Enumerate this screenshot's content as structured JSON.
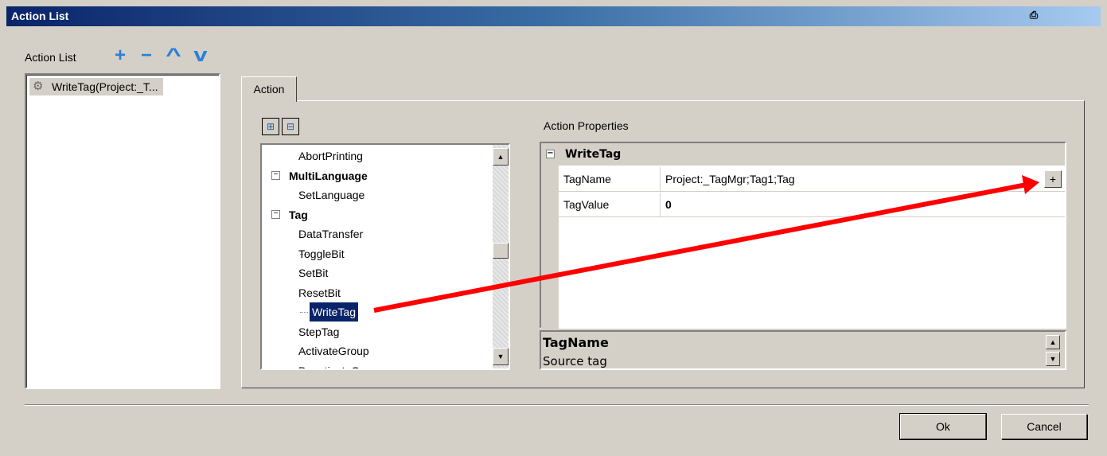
{
  "window": {
    "title": "Action List",
    "title_icon": "printer-icon"
  },
  "action_list": {
    "label": "Action List",
    "toolbar_icons": [
      "plus-icon",
      "minus-icon",
      "up-icon",
      "down-icon"
    ],
    "toolbar_glyphs": [
      "+",
      "−",
      "^",
      "v"
    ],
    "items": [
      {
        "label": "WriteTag(Project:_T...",
        "icon": "gear-icon"
      }
    ]
  },
  "tabs": [
    {
      "label": "Action"
    }
  ],
  "tree": {
    "items": [
      {
        "label": "AbortPrinting",
        "level": 2
      },
      {
        "label": "MultiLanguage",
        "level": 1,
        "expander": "−"
      },
      {
        "label": "SetLanguage",
        "level": 2
      },
      {
        "label": "Tag",
        "level": 1,
        "expander": "−"
      },
      {
        "label": "DataTransfer",
        "level": 2
      },
      {
        "label": "ToggleBit",
        "level": 2
      },
      {
        "label": "SetBit",
        "level": 2
      },
      {
        "label": "ResetBit",
        "level": 2
      },
      {
        "label": "WriteTag",
        "level": 2,
        "selected": true
      },
      {
        "label": "StepTag",
        "level": 2
      },
      {
        "label": "ActivateGroup",
        "level": 2
      },
      {
        "label": "DeactivateGroup",
        "level": 2
      }
    ]
  },
  "properties": {
    "label": "Action Properties",
    "group": "WriteTag",
    "group_expander": "−",
    "rows": [
      {
        "name": "TagName",
        "value": "Project:_TagMgr;Tag1;Tag",
        "button": "+"
      },
      {
        "name": "TagValue",
        "value": "0"
      }
    ],
    "description": {
      "title": "TagName",
      "text": "Source tag"
    }
  },
  "buttons": {
    "ok": "Ok",
    "cancel": "Cancel"
  },
  "colors": {
    "accent_arrow": "#ff0000",
    "selection": "#0a246a",
    "title_start": "#0a246a"
  }
}
